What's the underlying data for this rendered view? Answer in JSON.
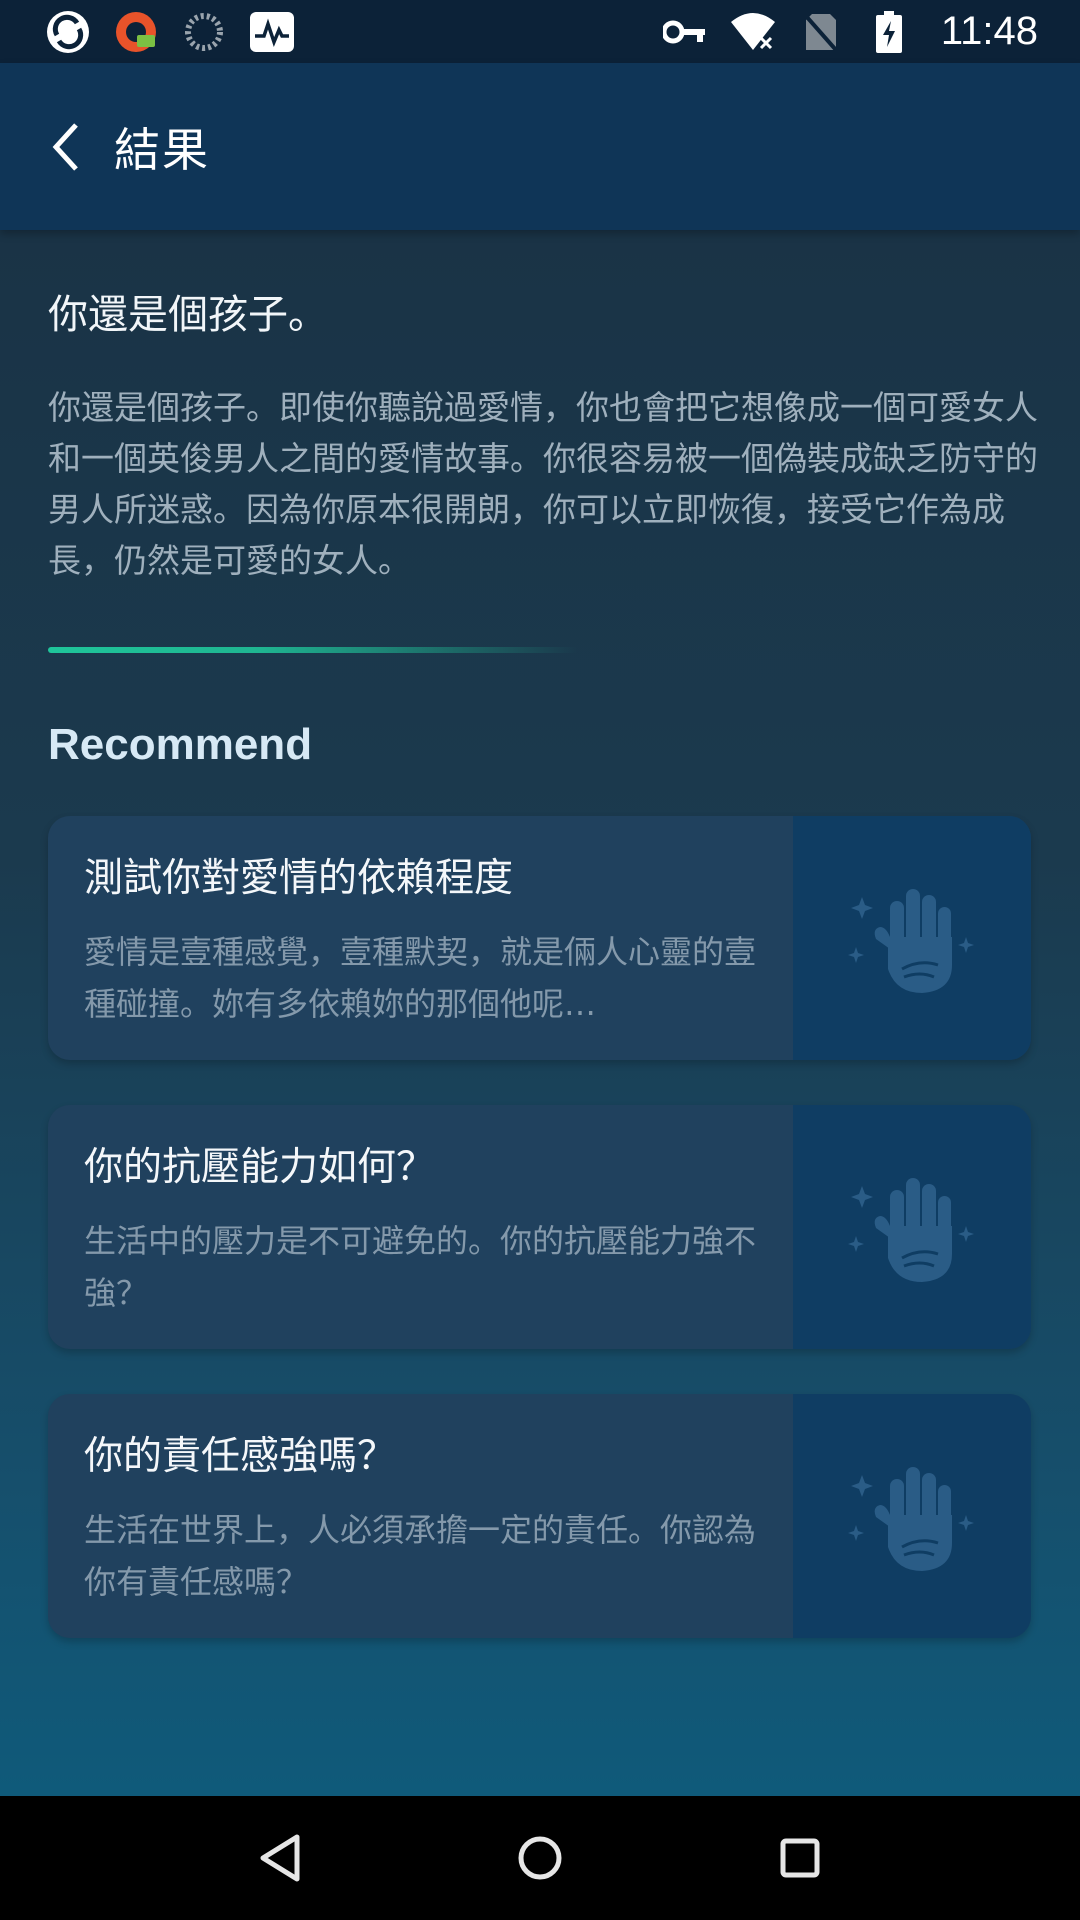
{
  "status_bar": {
    "time": "11:48",
    "left_icons": [
      "sync-app-icon",
      "camera-app-icon",
      "loading-icon",
      "activity-app-icon"
    ],
    "right_icons": [
      "vpn-key-icon",
      "wifi-off-icon",
      "no-sim-icon",
      "battery-charging-icon"
    ]
  },
  "app_bar": {
    "title": "結果"
  },
  "result": {
    "title": "你還是個孩子。",
    "description": "你還是個孩子。即使你聽說過愛情，你也會把它想像成一個可愛女人和一個英俊男人之間的愛情故事。你很容易被一個偽裝成缺乏防守的男人所迷惑。因為你原本很開朗，你可以立即恢復，接受它作為成長，仍然是可愛的女人。"
  },
  "recommend": {
    "section_title": "Recommend",
    "cards": [
      {
        "title": "測試你對愛情的依賴程度",
        "description": "愛情是壹種感覺，壹種默契，就是倆人心靈的壹種碰撞。妳有多依賴妳的那個他呢…",
        "icon": "palm-hand-icon"
      },
      {
        "title": "你的抗壓能力如何？",
        "description": "生活中的壓力是不可避免的。你的抗壓能力強不強？",
        "icon": "palm-hand-icon"
      },
      {
        "title": "你的責任感強嗎？",
        "description": "生活在世界上，人必須承擔一定的責任。你認為你有責任感嗎？",
        "icon": "palm-hand-icon"
      }
    ]
  },
  "nav_bar": {
    "buttons": [
      "back-triangle-icon",
      "home-circle-icon",
      "recents-square-icon"
    ]
  },
  "colors": {
    "accent": "#1fc59a",
    "app_bar": "#0f3557",
    "card": "#20415e",
    "thumb": "#0f3d63"
  }
}
